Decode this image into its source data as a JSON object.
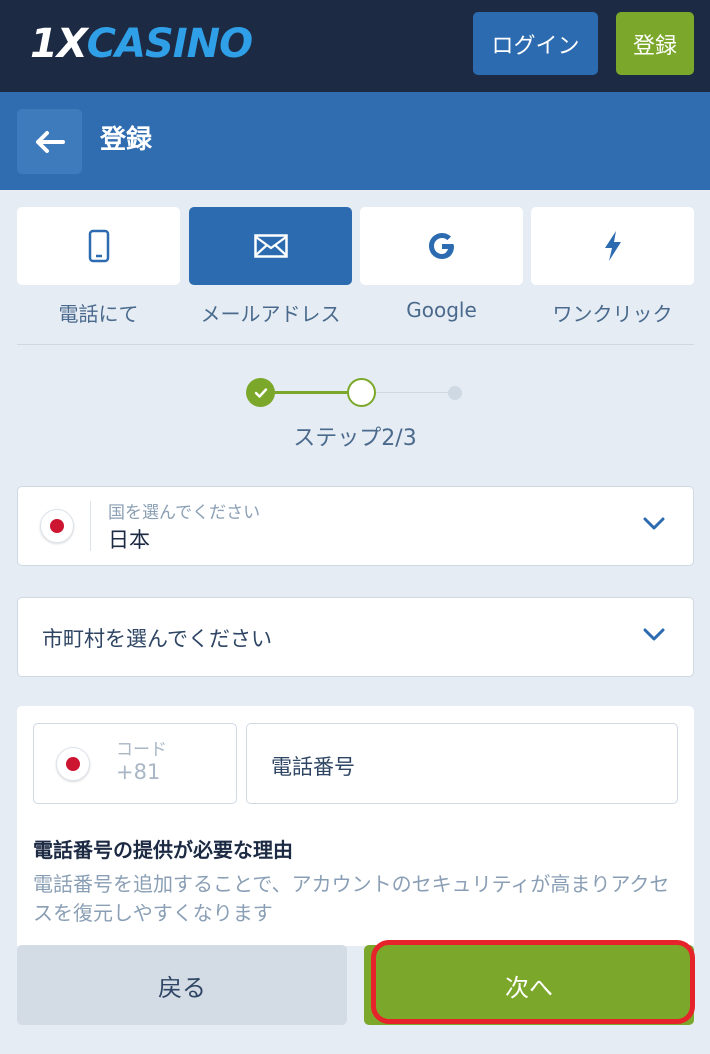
{
  "header": {
    "logo_prefix": "1X",
    "logo_name": "CASINO",
    "login_label": "ログイン",
    "register_label": "登録"
  },
  "subheader": {
    "back_icon": "arrow-left-icon",
    "title": "登録"
  },
  "methods": [
    {
      "label": "電話にて",
      "icon": "phone-icon",
      "active": false
    },
    {
      "label": "メールアドレス",
      "icon": "envelope-icon",
      "active": true
    },
    {
      "label": "Google",
      "icon": "google-icon",
      "active": false
    },
    {
      "label": "ワンクリック",
      "icon": "lightning-icon",
      "active": false
    }
  ],
  "stepper": {
    "current_step": 2,
    "total_steps": 3,
    "label": "ステップ2/3"
  },
  "country": {
    "placeholder": "国を選んでください",
    "value": "日本",
    "flag": "japan-flag"
  },
  "city": {
    "placeholder": "市町村を選んでください"
  },
  "phone": {
    "code_label": "コード",
    "code_value": "+81",
    "number_placeholder": "電話番号",
    "why_title": "電話番号の提供が必要な理由",
    "why_text": "電話番号を追加することで、アカウントのセキュリティが高まりアクセスを復元しやすくなります"
  },
  "actions": {
    "back_label": "戻る",
    "next_label": "次へ"
  },
  "colors": {
    "header_bg": "#1d2a43",
    "primary_blue": "#2c6bb0",
    "accent_green": "#7ba82b",
    "highlight_red": "#e6222b"
  }
}
